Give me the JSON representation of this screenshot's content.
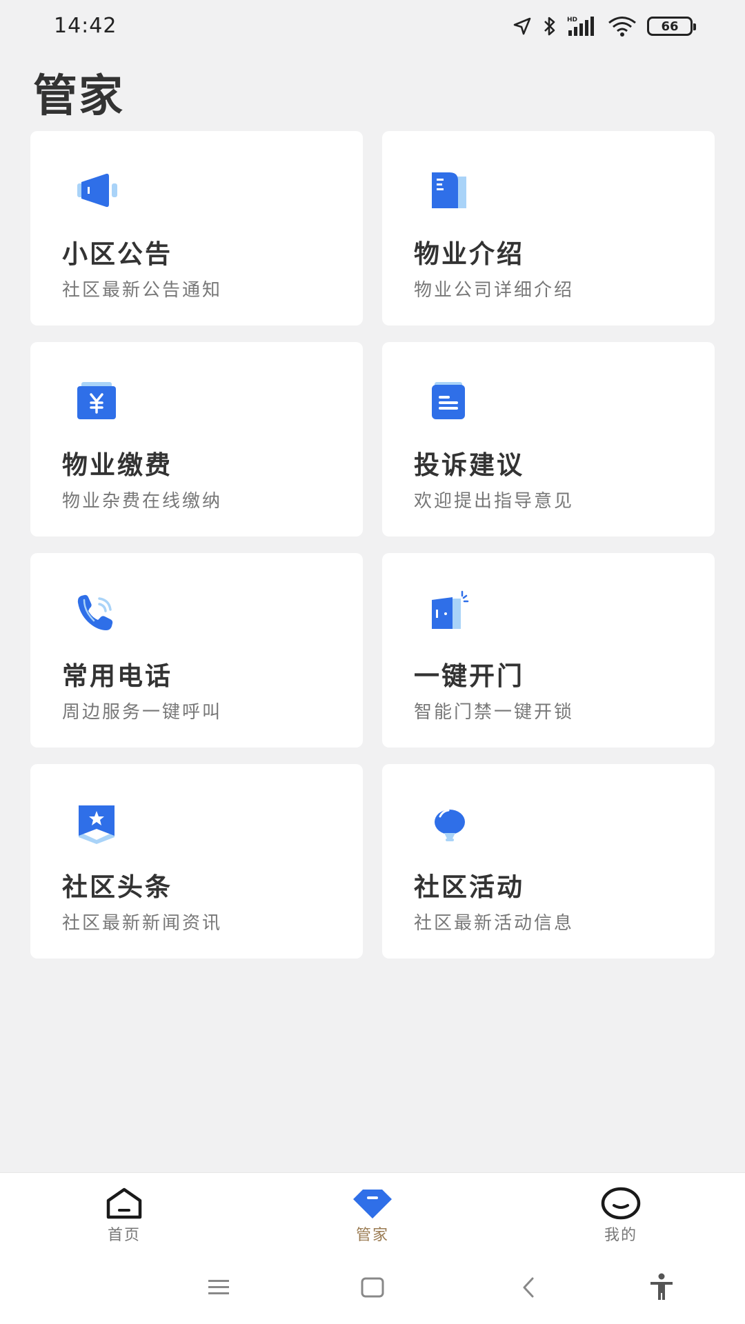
{
  "status_bar": {
    "time": "14:42",
    "battery": "66",
    "icons": [
      "location-icon",
      "bluetooth-icon",
      "hd-signal-icon",
      "wifi-icon",
      "battery-icon"
    ]
  },
  "page": {
    "title": "管家"
  },
  "cards": [
    {
      "icon": "megaphone-icon",
      "title": "小区公告",
      "subtitle": "社区最新公告通知"
    },
    {
      "icon": "document-icon",
      "title": "物业介绍",
      "subtitle": "物业公司详细介绍"
    },
    {
      "icon": "yuan-payment-icon",
      "title": "物业缴费",
      "subtitle": "物业杂费在线缴纳"
    },
    {
      "icon": "note-icon",
      "title": "投诉建议",
      "subtitle": "欢迎提出指导意见"
    },
    {
      "icon": "phone-call-icon",
      "title": "常用电话",
      "subtitle": "周边服务一键呼叫"
    },
    {
      "icon": "door-icon",
      "title": "一键开门",
      "subtitle": "智能门禁一键开锁"
    },
    {
      "icon": "star-bookmark-icon",
      "title": "社区头条",
      "subtitle": "社区最新新闻资讯"
    },
    {
      "icon": "balloon-icon",
      "title": "社区活动",
      "subtitle": "社区最新活动信息"
    }
  ],
  "tab_bar": {
    "items": [
      {
        "icon": "home-icon",
        "label": "首页",
        "active": false
      },
      {
        "icon": "diamond-icon",
        "label": "管家",
        "active": true
      },
      {
        "icon": "smile-icon",
        "label": "我的",
        "active": false
      }
    ]
  },
  "nav_bar": {
    "buttons": [
      "menu-icon",
      "home-square-icon",
      "back-icon",
      "accessibility-icon"
    ]
  },
  "colors": {
    "accent": "#2f6fe8",
    "accent_light": "#a9d3f8",
    "active_tab_label": "#9a7b52",
    "background": "#f1f1f2"
  }
}
